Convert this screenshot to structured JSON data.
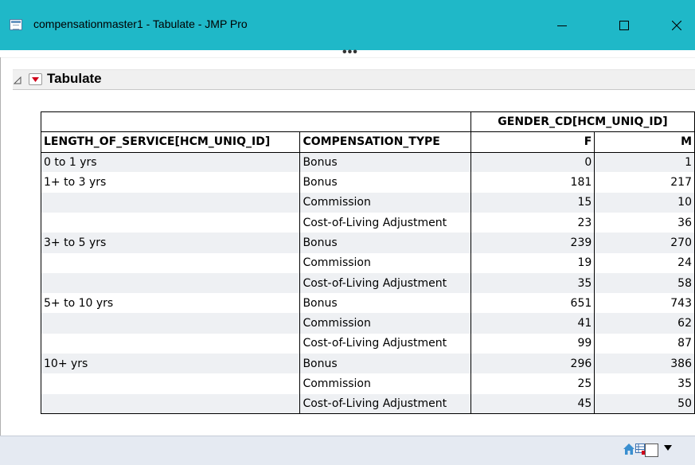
{
  "window": {
    "title": "compensationmaster1 - Tabulate - JMP Pro",
    "titlebar_color": "#1fb8c8"
  },
  "controls": {
    "minimize_icon": "minimize-icon",
    "maximize_icon": "maximize-icon",
    "close_icon": "close-icon",
    "more_dots": "•••"
  },
  "outline": {
    "title": "Tabulate",
    "disclosure_icon": "disclosure-triangle-icon",
    "menu_icon": "red-triangle-menu-icon",
    "accent": "#d0021b"
  },
  "table": {
    "group_header": "GENDER_CD[HCM_UNIQ_ID]",
    "columns": [
      "LENGTH_OF_SERVICE[HCM_UNIQ_ID]",
      "COMPENSATION_TYPE",
      "F",
      "M"
    ],
    "rows": [
      {
        "service": "0 to 1 yrs",
        "type": "Bonus",
        "f": "0",
        "m": "1"
      },
      {
        "service": "1+ to 3 yrs",
        "type": "Bonus",
        "f": "181",
        "m": "217"
      },
      {
        "service": "",
        "type": "Commission",
        "f": "15",
        "m": "10"
      },
      {
        "service": "",
        "type": "Cost-of-Living Adjustment",
        "f": "23",
        "m": "36"
      },
      {
        "service": "3+ to 5 yrs",
        "type": "Bonus",
        "f": "239",
        "m": "270"
      },
      {
        "service": "",
        "type": "Commission",
        "f": "19",
        "m": "24"
      },
      {
        "service": "",
        "type": "Cost-of-Living Adjustment",
        "f": "35",
        "m": "58"
      },
      {
        "service": "5+ to 10 yrs",
        "type": "Bonus",
        "f": "651",
        "m": "743"
      },
      {
        "service": "",
        "type": "Commission",
        "f": "41",
        "m": "62"
      },
      {
        "service": "",
        "type": "Cost-of-Living Adjustment",
        "f": "99",
        "m": "87"
      },
      {
        "service": "10+ yrs",
        "type": "Bonus",
        "f": "296",
        "m": "386"
      },
      {
        "service": "",
        "type": "Commission",
        "f": "25",
        "m": "35"
      },
      {
        "service": "",
        "type": "Cost-of-Living Adjustment",
        "f": "45",
        "m": "50"
      }
    ]
  },
  "status_bar": {
    "icons": [
      "home-icon",
      "data-table-icon",
      "checkbox-icon",
      "dropdown-arrow-icon"
    ]
  }
}
